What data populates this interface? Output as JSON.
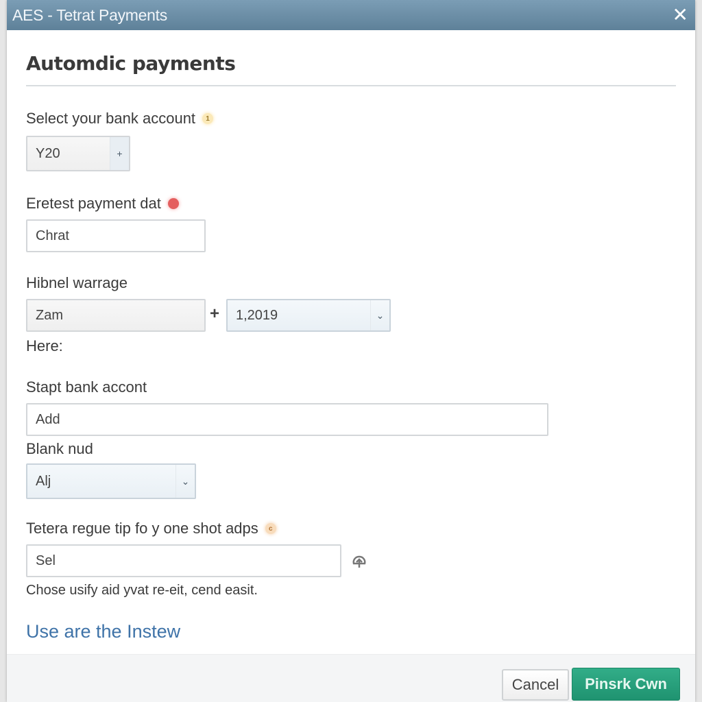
{
  "window": {
    "title": "AES - Tetrat Payments",
    "close_icon": "close-icon"
  },
  "heading": "Automdic payments",
  "fields": {
    "bank_account": {
      "label": "Select your bank account",
      "badge": "1",
      "badge_color": "#fbe9b8",
      "value": "Y20",
      "control_glyph": "+"
    },
    "payment_date": {
      "label": "Eretest payment dat",
      "badge": "!",
      "badge_color": "#e45f5f",
      "value": "Chrat"
    },
    "warrage": {
      "label": "Hibnel warrage",
      "left_value": "Zam",
      "joiner": "+",
      "right_value": "1,2019",
      "helper": "Here:"
    },
    "start_bank_account": {
      "label": "Stapt bank accont",
      "value": "Add"
    },
    "blank_nud": {
      "label": "Blank nud",
      "value": "Alj"
    },
    "one_shot": {
      "label": "Tetera regue tip fo y one shot adps",
      "badge": "c",
      "badge_color": "#f8dcbc",
      "value": "Sel",
      "upload_icon": "upload-icon",
      "helper": "Chose usify aid yvat re-eit, cend easit."
    }
  },
  "link": "Use are the Instew",
  "footer": {
    "cancel_label": "Cancel",
    "primary_label": "Pinsrk Cwn",
    "primary_color": "#22a07a"
  }
}
